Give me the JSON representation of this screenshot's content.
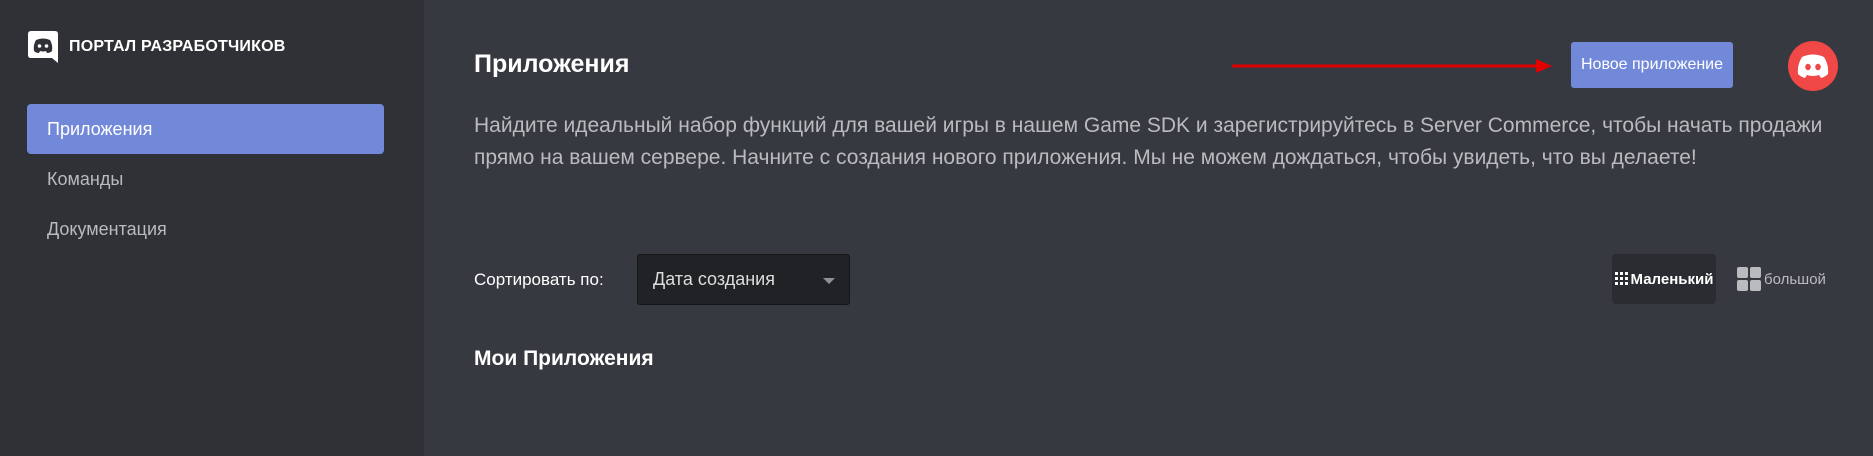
{
  "sidebar": {
    "brand_text": "ПОРТАЛ РАЗРАБОТЧИКОВ",
    "items": [
      {
        "label": "Приложения",
        "active": true
      },
      {
        "label": "Команды",
        "active": false
      },
      {
        "label": "Документация",
        "active": false
      }
    ]
  },
  "header": {
    "title": "Приложения",
    "new_app_label": "Новое приложение",
    "avatar_icon": "discord-logo-icon"
  },
  "description": "Найдите идеальный набор функций для вашей игры в нашем Game SDK и зарегистрируйтесь в Server Commerce, чтобы начать продажи прямо на вашем сервере. Начните с создания нового приложения. Мы не можем дождаться, чтобы увидеть, что вы делаете!",
  "sort": {
    "label": "Сортировать по:",
    "selected": "Дата создания"
  },
  "view_toggle": {
    "small_label": "Маленький",
    "large_label": "большой"
  },
  "section": {
    "title": "Мои Приложения"
  },
  "colors": {
    "accent": "#7289da",
    "avatar_bg": "#f04747",
    "arrow": "#e00000"
  }
}
